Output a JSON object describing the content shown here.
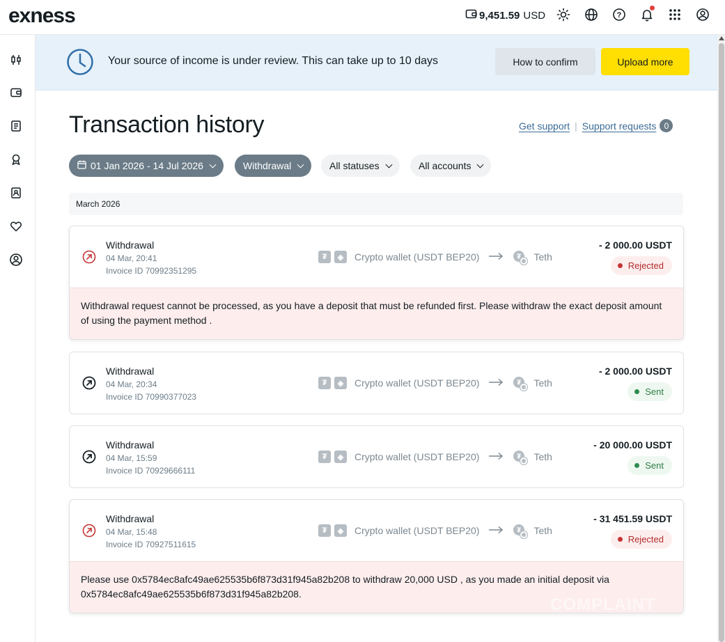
{
  "header": {
    "logo": "exness",
    "balance_amount": "9,451.59",
    "balance_currency": "USD",
    "icons": [
      "wallet-icon",
      "sun-icon",
      "globe-icon",
      "help-icon",
      "bell-icon",
      "apps-grid-icon",
      "profile-icon"
    ]
  },
  "sidebar": {
    "items": [
      "trading-icon",
      "wallet-icon",
      "reports-icon",
      "rewards-icon",
      "id-card-icon",
      "favorites-icon",
      "account-icon"
    ]
  },
  "banner": {
    "message": "Your source of income is under review. This can take up to 10 days",
    "confirm_label": "How to confirm",
    "upload_label": "Upload more"
  },
  "page": {
    "title": "Transaction history",
    "get_support": "Get support",
    "separator": "|",
    "support_requests": "Support requests",
    "support_count": "0"
  },
  "filters": {
    "date_range": "01 Jan 2026 - 14 Jul 2026",
    "type": "Withdrawal",
    "status": "All statuses",
    "accounts": "All accounts"
  },
  "month_header": "March 2026",
  "transactions": [
    {
      "title": "Withdrawal",
      "date": "04 Mar, 20:41",
      "invoice": "Invoice ID 70992351295",
      "method": "Crypto wallet (USDT BEP20)",
      "destination": "Teth",
      "amount": "- 2 000.00 USDT",
      "status": "Rejected",
      "note": "Withdrawal request cannot be processed, as you have a deposit that must be refunded first. Please withdraw the exact deposit amount of using the payment method ."
    },
    {
      "title": "Withdrawal",
      "date": "04 Mar, 20:34",
      "invoice": "Invoice ID 70990377023",
      "method": "Crypto wallet (USDT BEP20)",
      "destination": "Teth",
      "amount": "- 2 000.00 USDT",
      "status": "Sent"
    },
    {
      "title": "Withdrawal",
      "date": "04 Mar, 15:59",
      "invoice": "Invoice ID 70929666111",
      "method": "Crypto wallet (USDT BEP20)",
      "destination": "Teth",
      "amount": "- 20 000.00 USDT",
      "status": "Sent"
    },
    {
      "title": "Withdrawal",
      "date": "04 Mar, 15:48",
      "invoice": "Invoice ID 70927511615",
      "method": "Crypto wallet (USDT BEP20)",
      "destination": "Teth",
      "amount": "- 31 451.59 USDT",
      "status": "Rejected",
      "note": "Please use 0x5784ec8afc49ae625535b6f873d31f945a82b208 to withdraw 20,000 USD , as you made an initial deposit via 0x5784ec8afc49ae625535b6f873d31f945a82b208."
    }
  ],
  "watermark": "COMPLAINT",
  "colors": {
    "brand_yellow": "#ffde02",
    "banner_bg": "#e6f1fa",
    "rejected": "#c53434",
    "sent": "#2e8b4e",
    "filter_active": "#6b7c88"
  }
}
